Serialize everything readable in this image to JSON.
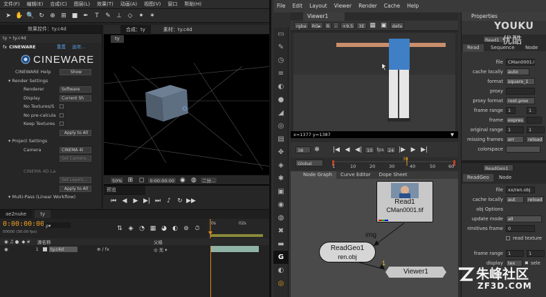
{
  "ae": {
    "menus": [
      "文件(F)",
      "编辑(E)",
      "合成(C)",
      "图层(L)",
      "效果(T)",
      "动画(A)",
      "视图(V)",
      "窗口",
      "帮助(H)"
    ],
    "effects_tab": "效果控件：ty.c4d",
    "layer_path": "ty • ty.c4d",
    "effect_name": "CINEWARE",
    "effect_reset": "重置",
    "effect_options": "选项...",
    "logo_text": "CINEWARE",
    "help_label": "CINEWARE Help",
    "show_btn": "Show",
    "render_settings": "Render Settings",
    "renderer_label": "Renderer",
    "renderer_value": "Software",
    "display_label": "Display",
    "display_value": "Current Sh",
    "no_textures": "No Textures/S",
    "no_precalc": "No pre-calcula",
    "keep_textures": "Keep Textures",
    "apply_all": "Apply to All",
    "project_settings": "Project Settings",
    "camera_label": "Camera",
    "camera_value": "CINEMA 4I",
    "set_camera": "Set Camera...",
    "c4d_layer": "CINEMA 4D La",
    "set_layers": "Set Layers...",
    "apply_all_2": "Apply to All",
    "multipass": "Multi-Pass (Linear Workflow)",
    "comp_tab": "合成：ty",
    "footage_tab": "素材：ty.c4d",
    "comp_name": "ty",
    "zoom": "50%",
    "timecode_small": "0:00:00:00",
    "resolution": "二分...",
    "preview_tab": "预览",
    "timeline_tabs": [
      "ae2nuke",
      "ty"
    ],
    "timecode": "0:00:00:00",
    "fps": "00000 (30.00 fps)",
    "col_layer_name": "源名称",
    "col_parent": "父级",
    "ruler_start": "0s",
    "ruler_02": "02s",
    "layer_num": "1",
    "layer_name": "ty.c4d"
  },
  "nuke": {
    "menus": [
      "File",
      "Edit",
      "Layout",
      "Viewer",
      "Render",
      "Cache",
      "Help"
    ],
    "viewer_tab": "Viewer1",
    "ch_rgba": "rgba",
    "ch_rgb": "RG▸",
    "ch_r": "R",
    "gain": "+9.5",
    "gamma": "3E",
    "layout": "defa",
    "coords": "x=1377 y=1387",
    "frame_in": "38",
    "fps_label": "fps",
    "fps_val": "24",
    "frame_step": "10",
    "scope": "Global",
    "ruler_ticks": [
      "10",
      "20",
      "30",
      "40",
      "50",
      "60"
    ],
    "ruler_left": "1",
    "ruler_marker": "38",
    "dag_tabs": [
      "Node Graph",
      "Curve Editor",
      "Dope Sheet"
    ],
    "read_node_label": "Read1",
    "read_node_file": "CMan0001.tif",
    "img_label": "img",
    "readgeo_label": "ReadGeo1",
    "readgeo_file": "ren.obj",
    "viewer_node": "Viewer1",
    "pipe_num": "1",
    "props_tab": "Properties",
    "read_tabs": [
      "Read",
      "Sequence",
      "Node"
    ],
    "read_header": "Read1",
    "p_file_label": "file",
    "p_file": "CMan0001.tif",
    "p_cache_label": "cache locally",
    "p_cache": "auto",
    "p_format_label": "format",
    "p_format": "square_1",
    "p_proxy_label": "proxy",
    "p_proxyfmt_label": "proxy format",
    "p_proxyfmt": "root.prox",
    "p_frange_label": "frame range",
    "p_frange_a": "1",
    "p_frange_b": "1",
    "p_frame_label": "frame",
    "p_frame": "expres",
    "p_orig_label": "original range",
    "p_orig_a": "1",
    "p_orig_b": "1",
    "p_missing_label": "missing frames",
    "p_missing": "err",
    "p_reload": "reload",
    "p_colorspace_label": "colorspace",
    "rg_header": "ReadGeo1",
    "rg_tabs": [
      "ReadGeo",
      "Node"
    ],
    "rg_file_label": "file",
    "rg_file": "xx/ren.obj",
    "rg_cache_label": "cache locally",
    "rg_cache": "aut",
    "rg_reload": "reload",
    "rg_objopts": "obj Options",
    "rg_update_label": "update mode",
    "rg_update": "all",
    "rg_prims_label": "rimitives frame",
    "rg_prims": "0",
    "rg_readtex": "read texture",
    "rg_frange_label": "frame range",
    "rg_frange_a": "1",
    "rg_frange_b": "1",
    "rg_display_label": "display",
    "rg_display": "tex",
    "rg_select": "sele"
  },
  "watermarks": {
    "youku": "YOUKU",
    "youku_cn": "优酷",
    "zf_cn": "朱峰社区",
    "zf_url": "ZF3D.COM"
  }
}
